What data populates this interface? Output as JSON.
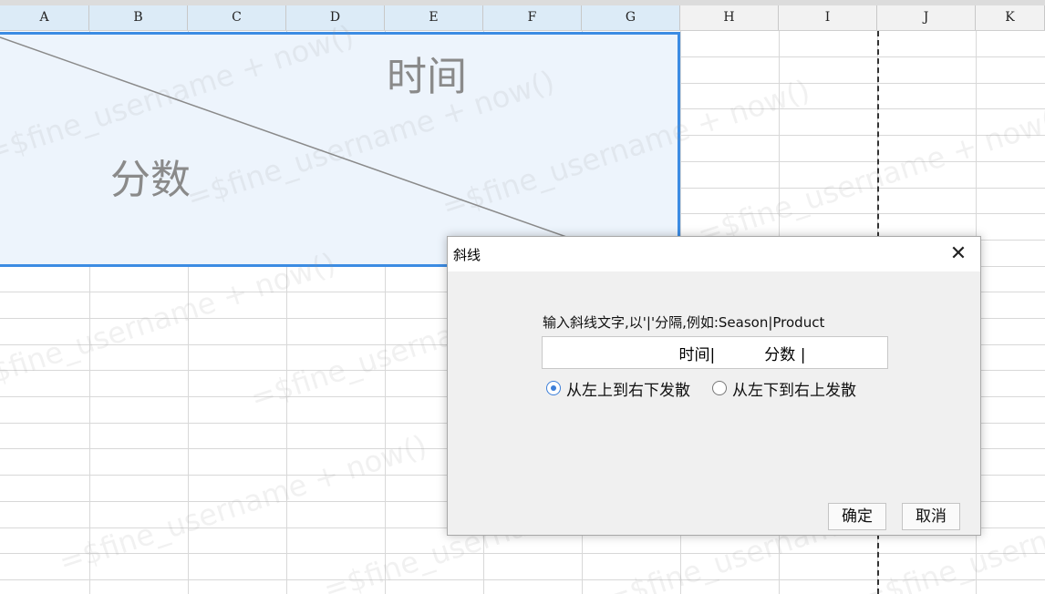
{
  "spreadsheet": {
    "columns": [
      "A",
      "B",
      "C",
      "D",
      "E",
      "F",
      "G",
      "H",
      "I",
      "J",
      "K"
    ],
    "selected_columns": [
      "A",
      "B",
      "C",
      "D",
      "E",
      "F",
      "G"
    ],
    "merged_cell": {
      "top_right_text": "时间",
      "bottom_left_text": "分数"
    }
  },
  "watermark": {
    "text": "=$fine_username + now()"
  },
  "dialog": {
    "title": "斜线",
    "close_icon": "close-icon",
    "prompt": "输入斜线文字,以'|'分隔,例如:Season|Product",
    "input_value": "时间|          分数 |",
    "radio_options": [
      {
        "label": "从左上到右下发散",
        "selected": true
      },
      {
        "label": "从左下到右上发散",
        "selected": false
      }
    ],
    "ok_label": "确定",
    "cancel_label": "取消"
  },
  "colors": {
    "selection_border": "#3c8ce3",
    "selection_fill": "#edf4fc",
    "header_selected": "#dcebf7"
  }
}
